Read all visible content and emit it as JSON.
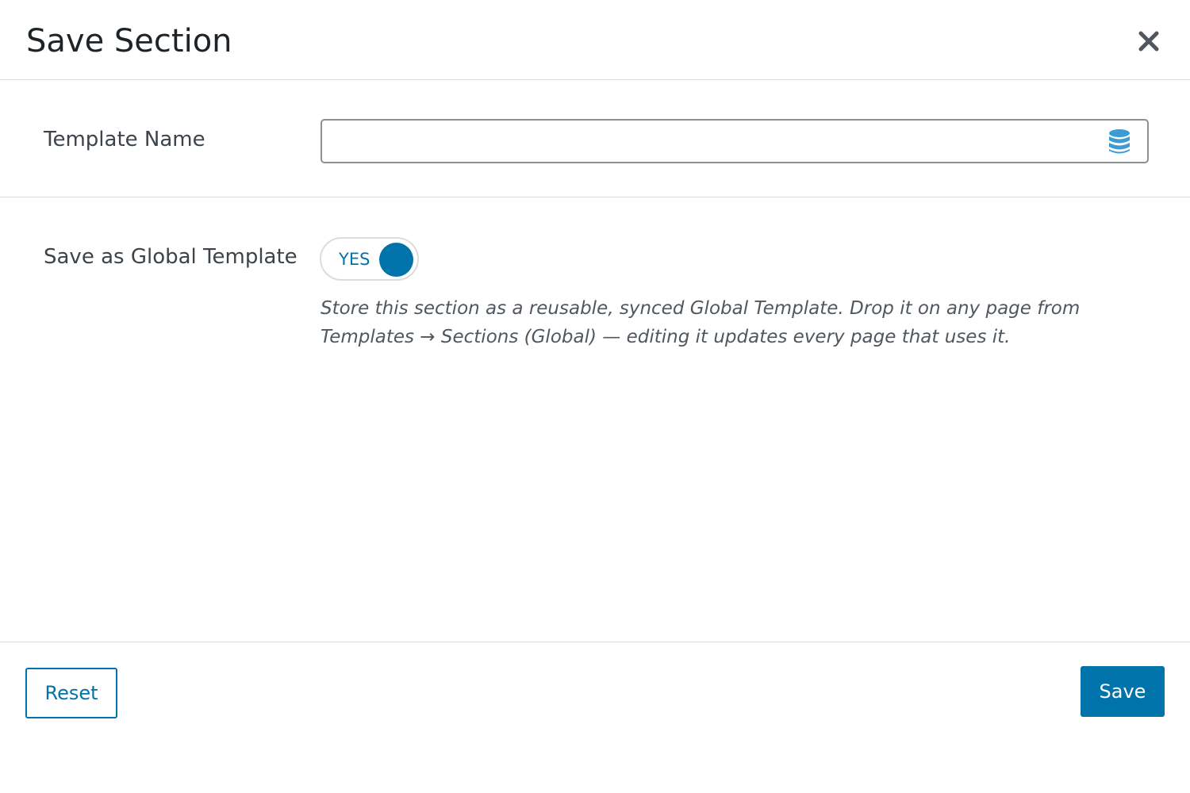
{
  "modal": {
    "title": "Save Section",
    "close_icon": "close-icon"
  },
  "template_name": {
    "label": "Template Name",
    "value": "",
    "placeholder": "",
    "icon": "database-icon"
  },
  "global_template": {
    "label": "Save as Global Template",
    "toggle_label": "YES",
    "enabled": true,
    "description": "Store this section as a reusable, synced Global Template. Drop it on any page from Templates → Sections (Global) — editing it updates every page that uses it."
  },
  "footer": {
    "reset_label": "Reset",
    "save_label": "Save"
  },
  "colors": {
    "accent": "#0073aa",
    "icon_blue": "#3a9bd5",
    "border": "#dcdcde",
    "text": "#1d2327"
  }
}
